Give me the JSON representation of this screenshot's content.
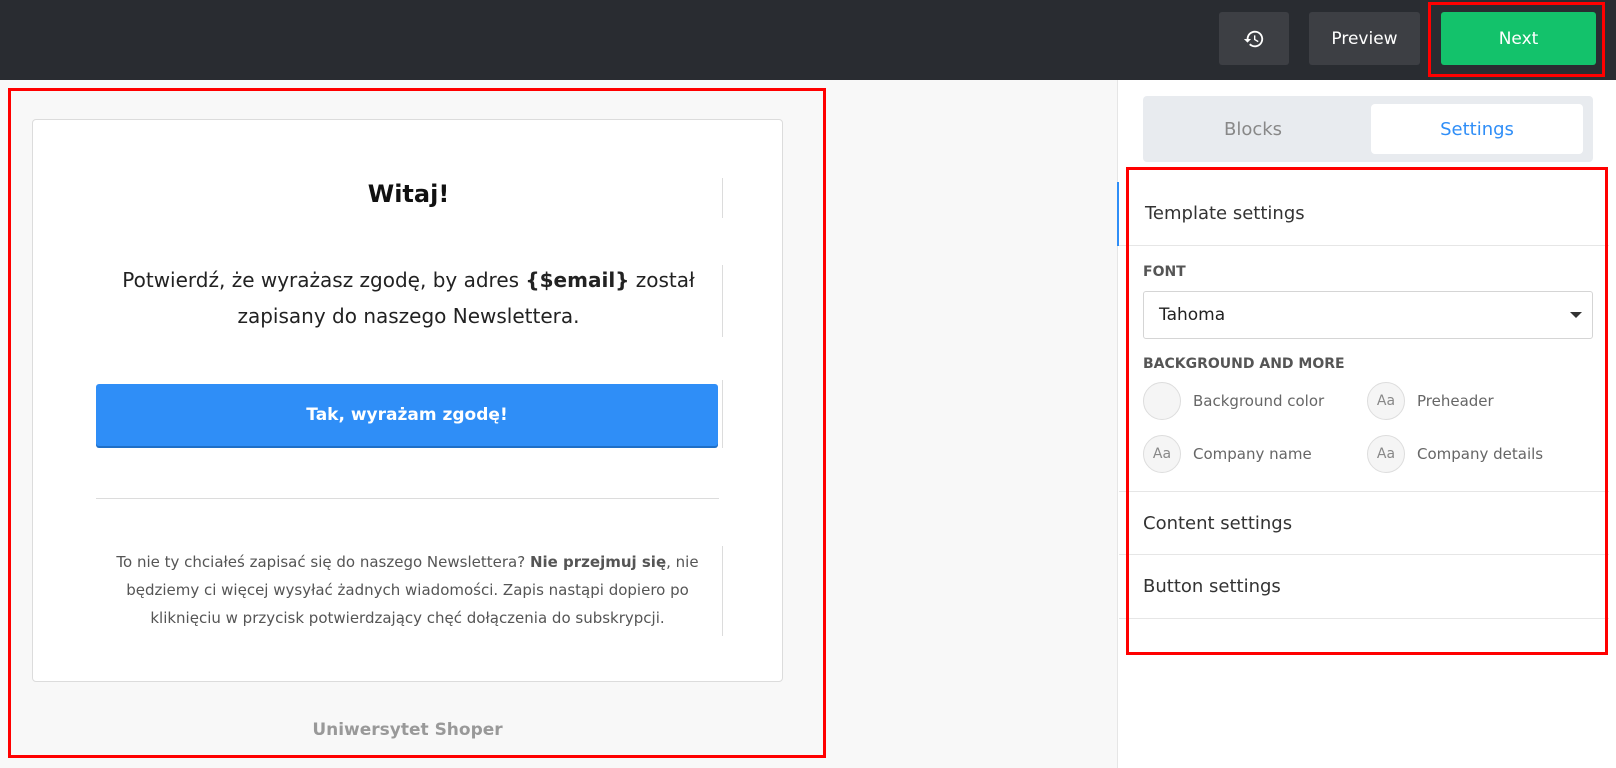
{
  "topbar": {
    "history_icon": "history-icon",
    "preview_label": "Preview",
    "next_label": "Next"
  },
  "email": {
    "title": "Witaj!",
    "confirm_text_part1": "Potwierdź, że wyrażasz zgodę, by adres ",
    "confirm_text_email": "{$email}",
    "confirm_text_part2": " został zapisany do naszego Newslettera.",
    "cta_label": "Tak, wyrażam zgodę!",
    "footer_text_part1": "To nie ty chciałeś zapisać się do naszego Newslettera? ",
    "footer_text_bold": "Nie przejmuj się",
    "footer_text_part2": ", nie będziemy ci więcej wysyłać żadnych wiadomości. Zapis nastąpi dopiero po kliknięciu w przycisk potwierdzający chęć dołączenia do subskrypcji.",
    "brand": "Uniwersytet Shoper"
  },
  "sidebar": {
    "tabs": [
      {
        "label": "Blocks"
      },
      {
        "label": "Settings"
      }
    ],
    "template_settings_label": "Template settings",
    "font_section_label": "FONT",
    "font_value": "Tahoma",
    "background_section_label": "BACKGROUND AND MORE",
    "options": [
      {
        "label": "Background color",
        "icon": ""
      },
      {
        "label": "Preheader",
        "icon": "Aa"
      },
      {
        "label": "Company name",
        "icon": "Aa"
      },
      {
        "label": "Company details",
        "icon": "Aa"
      }
    ],
    "content_settings_label": "Content settings",
    "button_settings_label": "Button settings"
  },
  "colors": {
    "accent": "#2f8ef7",
    "next_button": "#13c26b",
    "highlight": "#ff0000"
  }
}
